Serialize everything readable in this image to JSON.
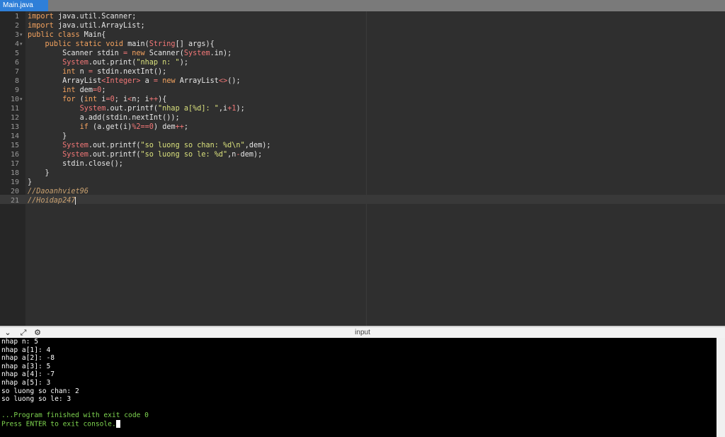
{
  "tab": {
    "label": "Main.java"
  },
  "editor": {
    "line_numbers": [
      "1",
      "2",
      "3",
      "4",
      "5",
      "6",
      "7",
      "8",
      "9",
      "10",
      "11",
      "12",
      "13",
      "14",
      "15",
      "16",
      "17",
      "18",
      "19",
      "20",
      "21"
    ],
    "fold_marker": "▾"
  },
  "code": {
    "l1": [
      "import",
      " java.util.Scanner;"
    ],
    "l2": [
      "import",
      " java.util.ArrayList;"
    ],
    "l3": [
      "public class",
      " Main{"
    ],
    "l4": [
      "    ",
      "public static void",
      " main(",
      "String",
      "[] args){"
    ],
    "l5": [
      "        Scanner stdin ",
      "=",
      " ",
      "new",
      " Scanner(",
      "System",
      ".in);"
    ],
    "l6": [
      "        ",
      "System",
      ".out.print(",
      "\"nhap n: \"",
      ");"
    ],
    "l7": [
      "        ",
      "int",
      " n ",
      "=",
      " stdin.nextInt();"
    ],
    "l8": [
      "        ArrayList",
      "<",
      "Integer",
      ">",
      " a ",
      "=",
      " ",
      "new",
      " ArrayList",
      "<>",
      "();"
    ],
    "l9": [
      "        ",
      "int",
      " dem",
      "=",
      "0",
      ";"
    ],
    "l10": [
      "        ",
      "for",
      " (",
      "int",
      " i",
      "=",
      "0",
      "; i",
      "<",
      "n; i",
      "++",
      "){"
    ],
    "l11": [
      "            ",
      "System",
      ".out.printf(",
      "\"nhap a[%d]: \"",
      ",i",
      "+",
      "1",
      ");"
    ],
    "l12": [
      "            a.add(stdin.nextInt());"
    ],
    "l13": [
      "            ",
      "if",
      " (a.get(i)",
      "%",
      "2",
      "==",
      "0",
      ") dem",
      "++",
      ";"
    ],
    "l14": [
      "        }"
    ],
    "l15": [
      "        ",
      "System",
      ".out.printf(",
      "\"so luong so chan: %d\\n\"",
      ",dem);"
    ],
    "l16": [
      "        ",
      "System",
      ".out.printf(",
      "\"so luong so le: %d\"",
      ",n",
      "-",
      "dem);"
    ],
    "l17": [
      "        stdin.close();"
    ],
    "l18": [
      "    }"
    ],
    "l19": [
      "}"
    ],
    "l20": [
      "//Daoanhviet96"
    ],
    "l21": [
      "//Hoidap247"
    ]
  },
  "console": {
    "title": "input",
    "icons": [
      "chevron-down-icon",
      "expand-icon",
      "debug-icon"
    ],
    "icon_glyphs": [
      "⌄",
      "⤢",
      "⚙"
    ],
    "lines": [
      "nhap n: 5",
      "nhap a[1]: 4",
      "nhap a[2]: -8",
      "nhap a[3]: 5",
      "nhap a[4]: -7",
      "nhap a[5]: 3",
      "so luong so chan: 2",
      "so luong so le: 3",
      "",
      "...Program finished with exit code 0",
      "Press ENTER to exit console."
    ]
  },
  "colors": {
    "keyword": "#f4a35f",
    "class": "#f27777",
    "string": "#d9e07c",
    "comment": "#c8a070",
    "console_green": "#7fd650",
    "tab_active": "#2f7fd8"
  }
}
